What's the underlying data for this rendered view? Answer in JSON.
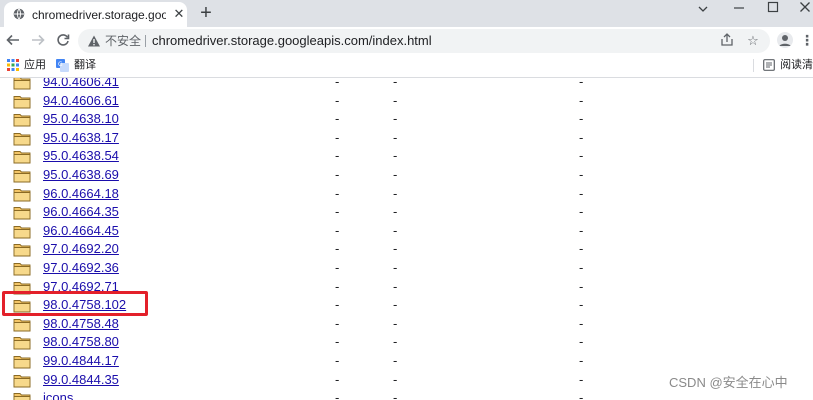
{
  "browser": {
    "tab": {
      "title": "chromedriver.storage.googleapis.com"
    },
    "omnibox": {
      "security_label": "不安全",
      "url": "chromedriver.storage.googleapis.com/index.html"
    },
    "bookmarks": [
      {
        "label": "应用"
      },
      {
        "label": "翻译"
      }
    ],
    "reading_list": "阅读清单"
  },
  "listing": {
    "rows": [
      {
        "name": "94.0.4606.41",
        "c1": "-",
        "c2": "-",
        "c3": "-"
      },
      {
        "name": "94.0.4606.61",
        "c1": "-",
        "c2": "-",
        "c3": "-"
      },
      {
        "name": "95.0.4638.10",
        "c1": "-",
        "c2": "-",
        "c3": "-"
      },
      {
        "name": "95.0.4638.17",
        "c1": "-",
        "c2": "-",
        "c3": "-"
      },
      {
        "name": "95.0.4638.54",
        "c1": "-",
        "c2": "-",
        "c3": "-"
      },
      {
        "name": "95.0.4638.69",
        "c1": "-",
        "c2": "-",
        "c3": "-"
      },
      {
        "name": "96.0.4664.18",
        "c1": "-",
        "c2": "-",
        "c3": "-"
      },
      {
        "name": "96.0.4664.35",
        "c1": "-",
        "c2": "-",
        "c3": "-"
      },
      {
        "name": "96.0.4664.45",
        "c1": "-",
        "c2": "-",
        "c3": "-"
      },
      {
        "name": "97.0.4692.20",
        "c1": "-",
        "c2": "-",
        "c3": "-"
      },
      {
        "name": "97.0.4692.36",
        "c1": "-",
        "c2": "-",
        "c3": "-"
      },
      {
        "name": "97.0.4692.71",
        "c1": "-",
        "c2": "-",
        "c3": "-"
      },
      {
        "name": "98.0.4758.102",
        "c1": "-",
        "c2": "-",
        "c3": "-",
        "highlighted": true
      },
      {
        "name": "98.0.4758.48",
        "c1": "-",
        "c2": "-",
        "c3": "-"
      },
      {
        "name": "98.0.4758.80",
        "c1": "-",
        "c2": "-",
        "c3": "-"
      },
      {
        "name": "99.0.4844.17",
        "c1": "-",
        "c2": "-",
        "c3": "-"
      },
      {
        "name": "99.0.4844.35",
        "c1": "-",
        "c2": "-",
        "c3": "-"
      },
      {
        "name": "icons",
        "c1": "-",
        "c2": "-",
        "c3": "-"
      }
    ]
  },
  "watermark": "CSDN @安全在心中",
  "colors": {
    "link": "#1a0dab",
    "highlight": "#e3202a",
    "tabstrip": "#dee1e6",
    "omnibox": "#f1f3f4"
  }
}
